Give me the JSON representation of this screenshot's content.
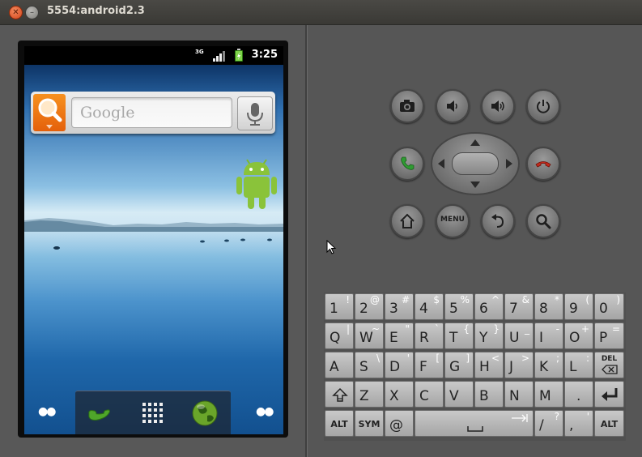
{
  "window": {
    "title": "5554:android2.3"
  },
  "status_bar": {
    "time": "3:25",
    "network": "3G"
  },
  "home": {
    "search_hint": "Google"
  },
  "controls": {
    "menu_label": "MENU"
  },
  "keyboard": {
    "row1": [
      [
        "1",
        "!"
      ],
      [
        "2",
        "@"
      ],
      [
        "3",
        "#"
      ],
      [
        "4",
        "$"
      ],
      [
        "5",
        "%"
      ],
      [
        "6",
        "^"
      ],
      [
        "7",
        "&"
      ],
      [
        "8",
        "*"
      ],
      [
        "9",
        "("
      ],
      [
        "0",
        ")"
      ]
    ],
    "row2": [
      [
        "Q",
        "|"
      ],
      [
        "W",
        "~"
      ],
      [
        "E",
        "\""
      ],
      [
        "R",
        "`"
      ],
      [
        "T",
        "{"
      ],
      [
        "Y",
        "}"
      ],
      [
        "U",
        "_"
      ],
      [
        "I",
        "-"
      ],
      [
        "O",
        "+"
      ],
      [
        "P",
        "="
      ]
    ],
    "row3": [
      [
        "A",
        ""
      ],
      [
        "S",
        "\\"
      ],
      [
        "D",
        "'"
      ],
      [
        "F",
        "["
      ],
      [
        "G",
        "]"
      ],
      [
        "H",
        "<"
      ],
      [
        "J",
        ">"
      ],
      [
        "K",
        ";"
      ],
      [
        "L",
        ":"
      ]
    ],
    "row4": [
      [
        "Z",
        ""
      ],
      [
        "X",
        ""
      ],
      [
        "C",
        ""
      ],
      [
        "V",
        ""
      ],
      [
        "B",
        ""
      ],
      [
        "N",
        ""
      ],
      [
        "M",
        ""
      ],
      [
        ".",
        ""
      ]
    ],
    "row5": {
      "alt": "ALT",
      "sym": "SYM",
      "at": "@",
      "slash": "/",
      "slash_alt": "?",
      "comma": ",",
      "comma_alt": "'",
      "alt_right": "ALT"
    },
    "del_label": "DEL"
  }
}
